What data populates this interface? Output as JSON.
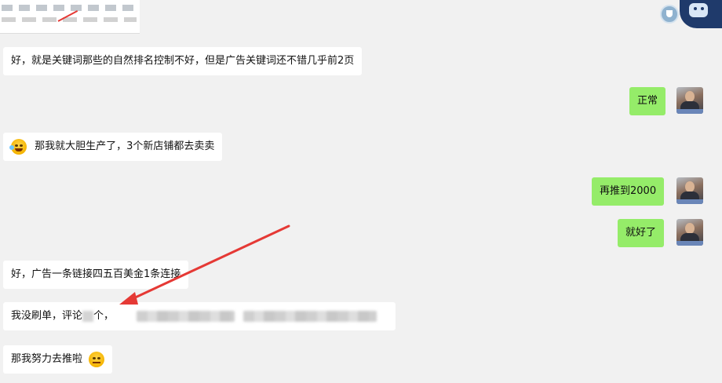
{
  "messages": [
    {
      "id": "m1",
      "side": "left",
      "text": "好，就是关键词那些的自然排名控制不好，但是广告关键词还不错几乎前2页"
    },
    {
      "id": "m2",
      "side": "right",
      "text": "正常"
    },
    {
      "id": "m3",
      "side": "left",
      "emoji": "laugh-tears-emoji",
      "text": "那我就大胆生产了，3个新店铺都去卖卖"
    },
    {
      "id": "m4",
      "side": "right",
      "text": "再推到2000"
    },
    {
      "id": "m5",
      "side": "right",
      "text": "就好了"
    },
    {
      "id": "m6",
      "side": "left",
      "text": "好，广告一条链接四五百美金1条连接"
    },
    {
      "id": "m7",
      "side": "left",
      "text_prefix": "我没刷单，评论",
      "text_suffix": "个，"
    },
    {
      "id": "m8",
      "side": "left",
      "text": "那我努力去推啦",
      "emoji": "smug-emoji"
    }
  ],
  "colors": {
    "chat_bg": "#f1f1f1",
    "bubble_left": "#ffffff",
    "bubble_right": "#95ec69",
    "annotation_arrow": "#e53935"
  },
  "icons": [
    "shield-badge-icon",
    "mascot-icon",
    "laugh-tears-emoji",
    "smug-emoji"
  ]
}
